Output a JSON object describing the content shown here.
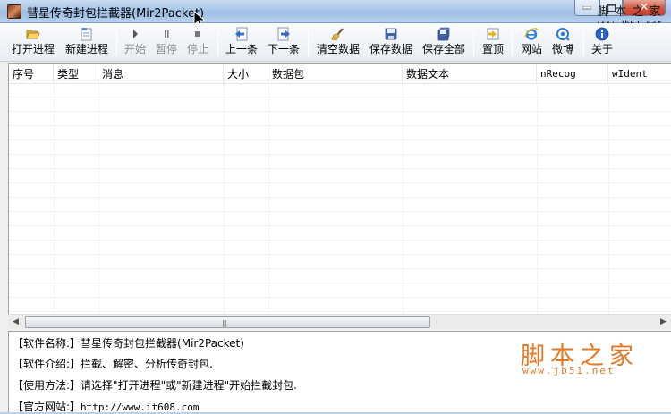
{
  "window": {
    "title": "彗星传奇封包拦截器(Mir2Packet)",
    "close_glyph": "✕",
    "watermark_top": "脚 本 之 家",
    "watermark_top_url": "www.Jb51.net"
  },
  "toolbar": {
    "buttons": [
      {
        "label": "打开进程",
        "icon": "open-folder-icon",
        "enabled": true
      },
      {
        "label": "新建进程",
        "icon": "new-process-icon",
        "enabled": true
      },
      {
        "label": "开始",
        "icon": "play-icon",
        "enabled": false
      },
      {
        "label": "暂停",
        "icon": "pause-icon",
        "enabled": false
      },
      {
        "label": "停止",
        "icon": "stop-icon",
        "enabled": false
      },
      {
        "label": "上一条",
        "icon": "previous-icon",
        "enabled": true
      },
      {
        "label": "下一条",
        "icon": "next-icon",
        "enabled": true
      },
      {
        "label": "清空数据",
        "icon": "broom-icon",
        "enabled": true
      },
      {
        "label": "保存数据",
        "icon": "save-icon",
        "enabled": true
      },
      {
        "label": "保存全部",
        "icon": "save-all-icon",
        "enabled": true
      },
      {
        "label": "置顶",
        "icon": "pin-top-icon",
        "enabled": true
      },
      {
        "label": "网站",
        "icon": "ie-browser-icon",
        "enabled": true
      },
      {
        "label": "微博",
        "icon": "weibo-icon",
        "enabled": true
      },
      {
        "label": "关于",
        "icon": "info-icon",
        "enabled": true
      }
    ]
  },
  "table": {
    "columns": [
      "序号",
      "类型",
      "消息",
      "大小",
      "数据包",
      "数据文本",
      "nRecog",
      "wIdent"
    ],
    "rows": []
  },
  "info": {
    "lines": [
      {
        "label": "【软件名称:】",
        "value": "彗星传奇封包拦截器(Mir2Packet)"
      },
      {
        "label": "【软件介绍:】",
        "value": "拦截、解密、分析传奇封包."
      },
      {
        "label": "【使用方法:】",
        "value": "请选择\"打开进程\"或\"新建进程\"开始拦截封包."
      },
      {
        "label": "【官方网站:】",
        "value": "http://www.it608.com"
      }
    ]
  },
  "watermark": {
    "logo": "脚本之家",
    "url": "www.jb51.net"
  },
  "colors": {
    "watermark_orange": "#e87722",
    "titlebar_blue": "#a9c6e9",
    "close_red": "#c43a24"
  }
}
